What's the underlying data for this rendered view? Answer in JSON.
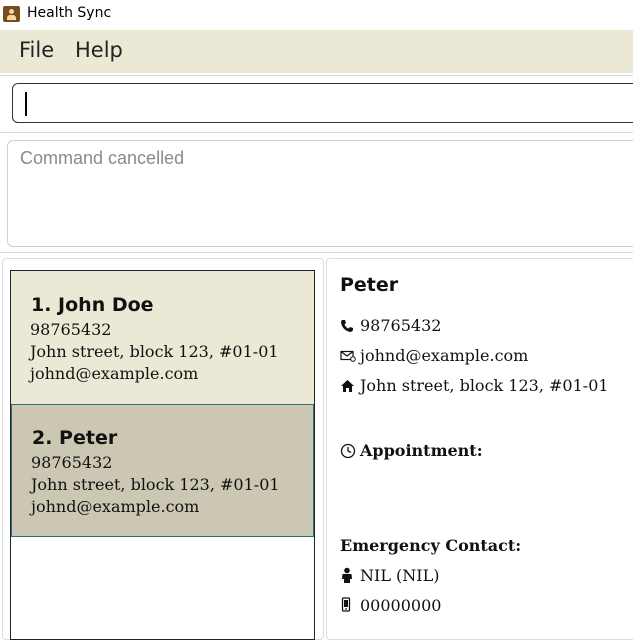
{
  "window": {
    "title": "Health Sync"
  },
  "menu": {
    "items": [
      "File",
      "Help"
    ]
  },
  "command": {
    "value": ""
  },
  "result": {
    "text": "Command cancelled"
  },
  "persons": [
    {
      "index_name": "1. John Doe",
      "phone": "98765432",
      "address": "John street, block 123, #01-01",
      "email": "johnd@example.com"
    },
    {
      "index_name": "2. Peter",
      "phone": "98765432",
      "address": "John street, block 123, #01-01",
      "email": "johnd@example.com"
    }
  ],
  "detail": {
    "name": "Peter",
    "phone": "98765432",
    "email": "johnd@example.com",
    "address": "John street, block 123, #01-01",
    "appointment_label": "Appointment:",
    "emergency_label": "Emergency Contact:",
    "emergency_name": "NIL (NIL)",
    "emergency_phone": "00000000"
  },
  "colors": {
    "menu_bg": "#ece8d6",
    "card_bg": "#ece8d6",
    "card_selected_bg": "#cbc7b3",
    "selected_border": "#2f6f7a"
  },
  "icons": [
    "app-icon",
    "phone-icon",
    "email-icon",
    "home-icon",
    "clock-icon",
    "person-icon",
    "mobile-icon"
  ]
}
